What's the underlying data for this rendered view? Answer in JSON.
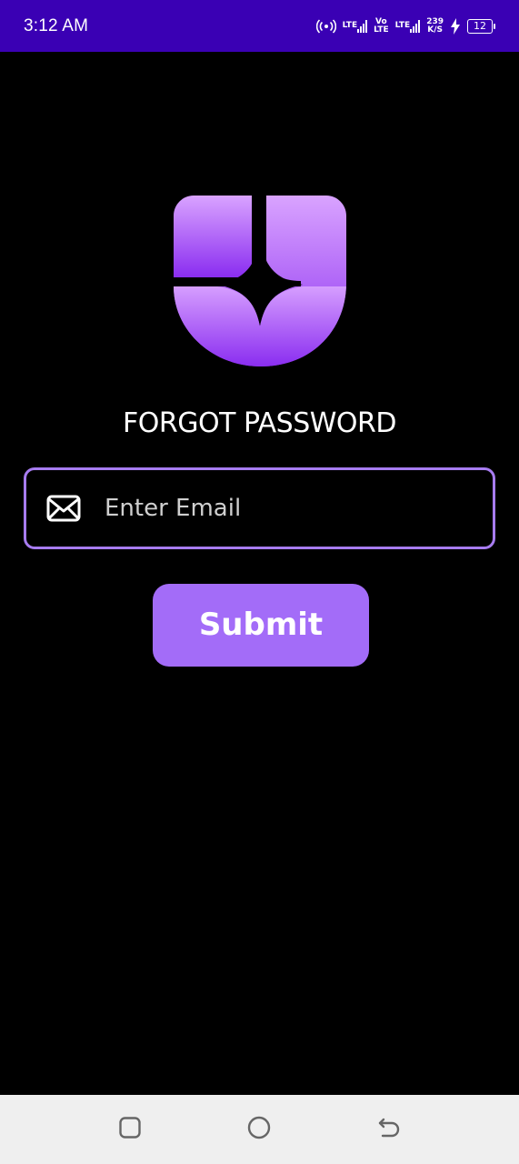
{
  "status_bar": {
    "time": "3:12 AM",
    "lte1": "LTE",
    "volte_top": "Vo",
    "volte_bottom": "LTE",
    "lte2": "LTE",
    "net_speed_value": "239",
    "net_speed_unit": "K/S",
    "battery_level": "12",
    "background_color": "#3a00b4"
  },
  "page": {
    "title": "FORGOT PASSWORD"
  },
  "email": {
    "placeholder": "Enter Email",
    "value": ""
  },
  "submit": {
    "label": "Submit"
  },
  "colors": {
    "accent": "#a36cf8",
    "field_border": "#a77cf0",
    "logo_top": "#d9a3ff",
    "logo_bottom": "#8a2df0"
  },
  "icons": {
    "mail": "mail-icon",
    "hotspot": "hotspot-icon",
    "charging": "charging-bolt-icon",
    "nav_recents": "recents-square-icon",
    "nav_home": "home-circle-icon",
    "nav_back": "back-arrow-icon"
  }
}
